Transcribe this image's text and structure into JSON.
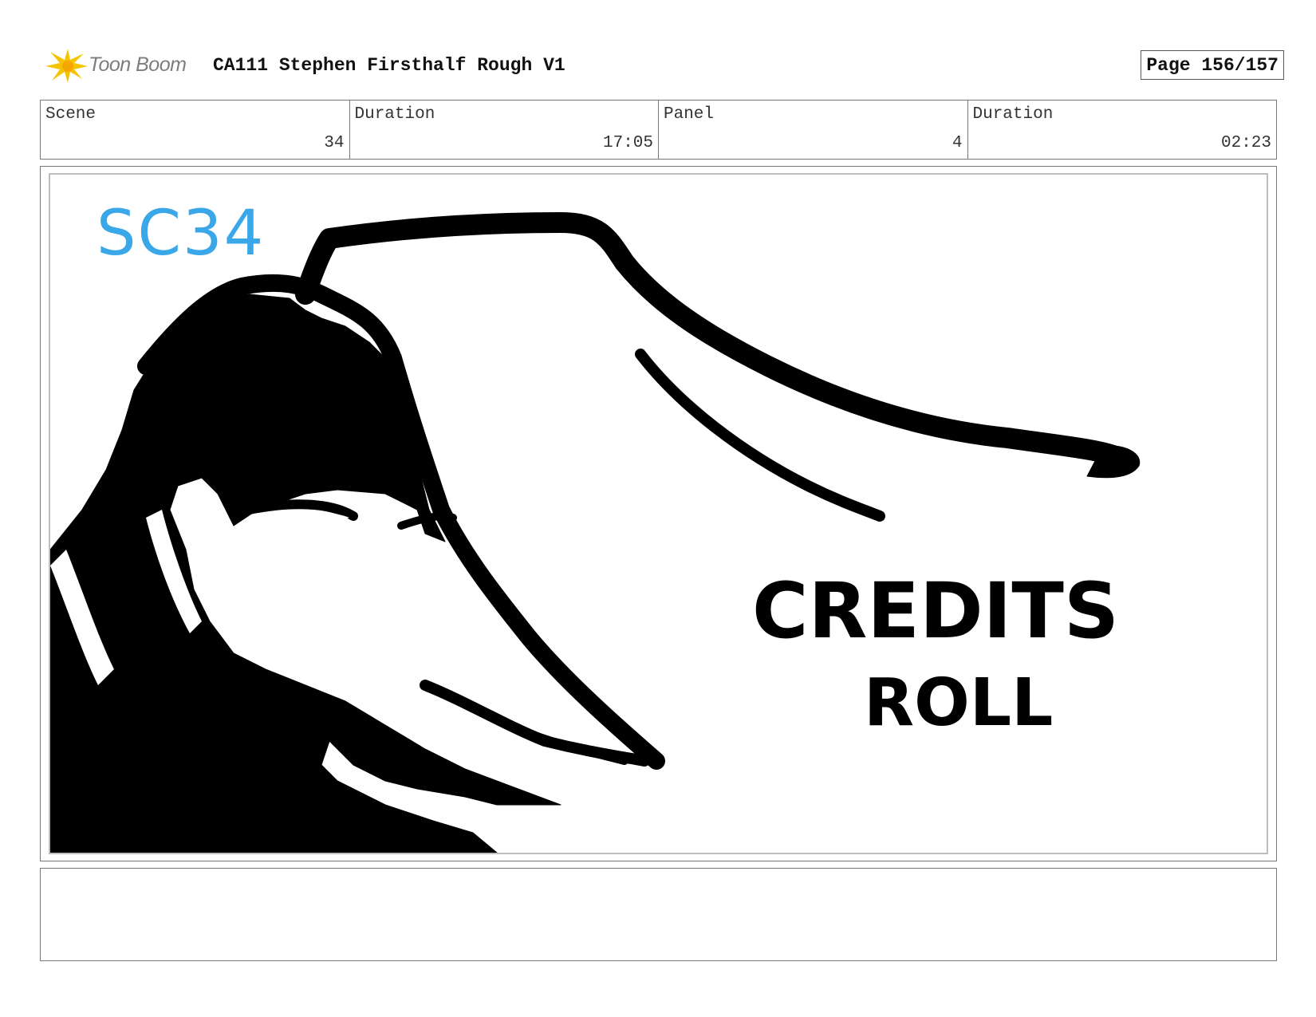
{
  "header": {
    "logo_text": "Toon Boom",
    "title": "CA111 Stephen Firsthalf Rough V1",
    "page_label": "Page 156/157"
  },
  "info": [
    {
      "label": "Scene",
      "value": "34"
    },
    {
      "label": "Duration",
      "value": "17:05"
    },
    {
      "label": "Panel",
      "value": "4"
    },
    {
      "label": "Duration",
      "value": "02:23"
    }
  ],
  "panel": {
    "scene_tag": "SC34",
    "caption_line1": "CREDITS",
    "caption_line2": "ROLL",
    "scene_tag_color": "#3aa7e8",
    "ink_color": "#000000"
  },
  "notes": {
    "text": ""
  }
}
